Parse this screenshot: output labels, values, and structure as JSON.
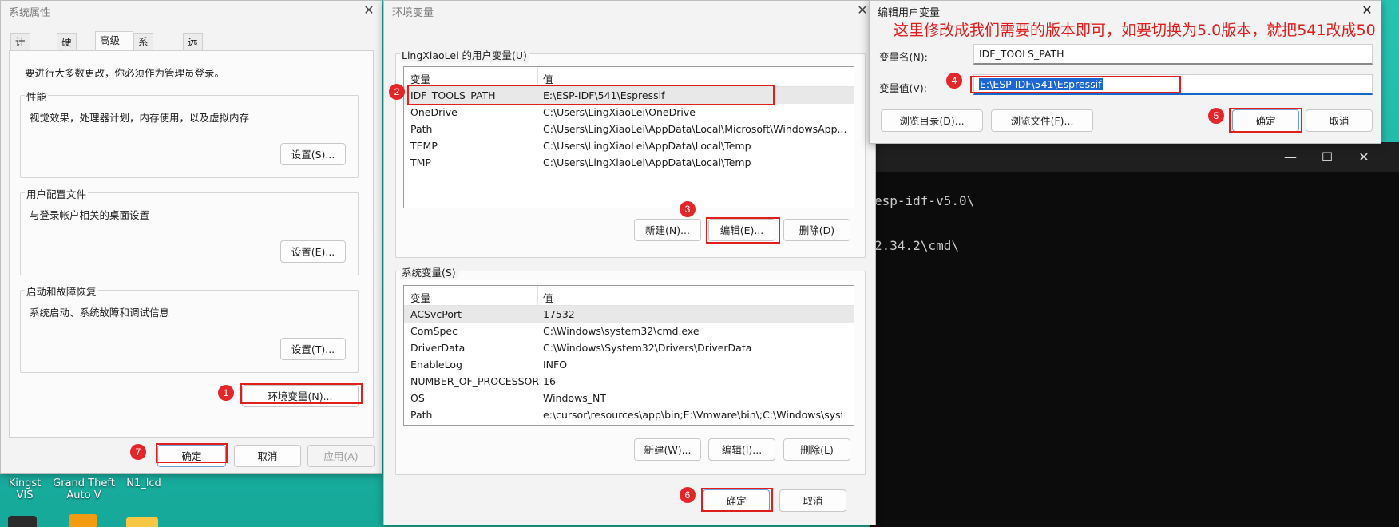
{
  "desktop": {
    "icons": [
      {
        "label": "Kingst VIS"
      },
      {
        "label": "Grand Theft Auto V"
      },
      {
        "label": "N1_lcd"
      }
    ]
  },
  "terminal": {
    "lines": [
      "esp-idf-v5.0\\",
      "2.34.2\\cmd\\"
    ]
  },
  "sys_props": {
    "title": "系统属性",
    "tabs": [
      "计算机名",
      "硬件",
      "高级",
      "系统保护",
      "远程"
    ],
    "active_tab": "高级",
    "admin_note": "要进行大多数更改，你必须作为管理员登录。",
    "performance": {
      "label": "性能",
      "desc": "视觉效果，处理器计划，内存使用，以及虚拟内存",
      "button": "设置(S)..."
    },
    "profiles": {
      "label": "用户配置文件",
      "desc": "与登录帐户相关的桌面设置",
      "button": "设置(E)..."
    },
    "startup": {
      "label": "启动和故障恢复",
      "desc": "系统启动、系统故障和调试信息",
      "button": "设置(T)..."
    },
    "env_button": "环境变量(N)...",
    "ok": "确定",
    "cancel": "取消",
    "apply": "应用(A)"
  },
  "env_vars": {
    "title": "环境变量",
    "user_label": "LingXiaoLei 的用户变量(U)",
    "col_var": "变量",
    "col_val": "值",
    "user_rows": [
      {
        "name": "IDF_TOOLS_PATH",
        "value": "E:\\ESP-IDF\\541\\Espressif"
      },
      {
        "name": "OneDrive",
        "value": "C:\\Users\\LingXiaoLei\\OneDrive"
      },
      {
        "name": "Path",
        "value": "C:\\Users\\LingXiaoLei\\AppData\\Local\\Microsoft\\WindowsApp..."
      },
      {
        "name": "TEMP",
        "value": "C:\\Users\\LingXiaoLei\\AppData\\Local\\Temp"
      },
      {
        "name": "TMP",
        "value": "C:\\Users\\LingXiaoLei\\AppData\\Local\\Temp"
      }
    ],
    "user_new": "新建(N)...",
    "user_edit": "编辑(E)...",
    "user_delete": "删除(D)",
    "sys_label": "系统变量(S)",
    "sys_rows": [
      {
        "name": "ACSvcPort",
        "value": "17532"
      },
      {
        "name": "ComSpec",
        "value": "C:\\Windows\\system32\\cmd.exe"
      },
      {
        "name": "DriverData",
        "value": "C:\\Windows\\System32\\Drivers\\DriverData"
      },
      {
        "name": "EnableLog",
        "value": "INFO"
      },
      {
        "name": "NUMBER_OF_PROCESSORS",
        "value": "16"
      },
      {
        "name": "OS",
        "value": "Windows_NT"
      },
      {
        "name": "Path",
        "value": "e:\\cursor\\resources\\app\\bin;E:\\Vmware\\bin\\;C:\\Windows\\syst..."
      }
    ],
    "sys_new": "新建(W)...",
    "sys_edit": "编辑(I)...",
    "sys_delete": "删除(L)",
    "ok": "确定",
    "cancel": "取消"
  },
  "edit_var": {
    "title": "编辑用户变量",
    "annotation": "这里修改成我们需要的版本即可，如要切换为5.0版本，就把541改成50",
    "name_label": "变量名(N):",
    "name_value": "IDF_TOOLS_PATH",
    "value_label": "变量值(V):",
    "value_value": "E:\\ESP-IDF\\541\\Espressif",
    "browse_dir": "浏览目录(D)...",
    "browse_file": "浏览文件(F)...",
    "ok": "确定",
    "cancel": "取消"
  },
  "steps": [
    "1",
    "2",
    "3",
    "4",
    "5",
    "6",
    "7"
  ],
  "colors": {
    "annotation_red": "#e3262a",
    "selection_blue": "#1a66d3"
  }
}
